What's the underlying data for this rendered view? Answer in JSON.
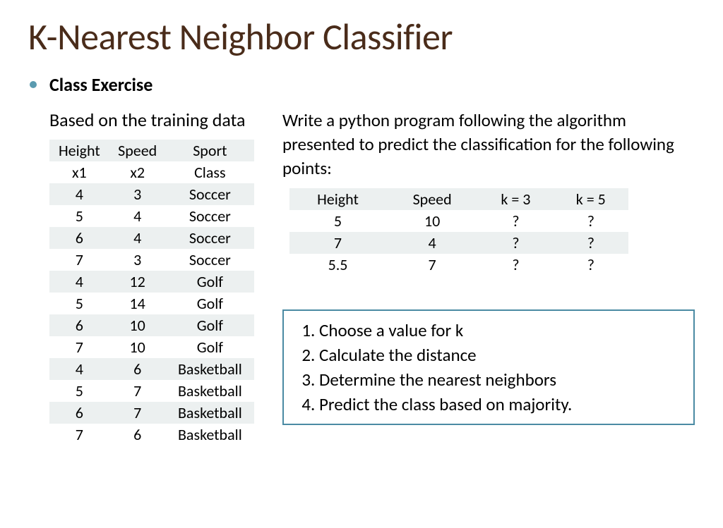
{
  "title": "K-Nearest Neighbor Classifier",
  "exercise_label": "Class Exercise",
  "left_subhead": "Based on the training data",
  "training_headers1": [
    "Height",
    "Speed",
    "Sport"
  ],
  "training_headers2": [
    "x1",
    "x2",
    "Class"
  ],
  "training_rows": [
    [
      "4",
      "3",
      "Soccer"
    ],
    [
      "5",
      "4",
      "Soccer"
    ],
    [
      "6",
      "4",
      "Soccer"
    ],
    [
      "7",
      "3",
      "Soccer"
    ],
    [
      "4",
      "12",
      "Golf"
    ],
    [
      "5",
      "14",
      "Golf"
    ],
    [
      "6",
      "10",
      "Golf"
    ],
    [
      "7",
      "10",
      "Golf"
    ],
    [
      "4",
      "6",
      "Basketball"
    ],
    [
      "5",
      "7",
      "Basketball"
    ],
    [
      "6",
      "7",
      "Basketball"
    ],
    [
      "7",
      "6",
      "Basketball"
    ]
  ],
  "right_instr": "Write a python program following the algorithm presented to predict the classification for the following points:",
  "pred_headers": [
    "Height",
    "Speed",
    "k = 3",
    "k = 5"
  ],
  "pred_rows": [
    [
      "5",
      "10",
      "?",
      "?"
    ],
    [
      "7",
      "4",
      "?",
      "?"
    ],
    [
      "5.5",
      "7",
      "?",
      "?"
    ]
  ],
  "steps": [
    "Choose a value for k",
    "Calculate the distance",
    "Determine the nearest neighbors",
    "Predict the class based on majority."
  ]
}
